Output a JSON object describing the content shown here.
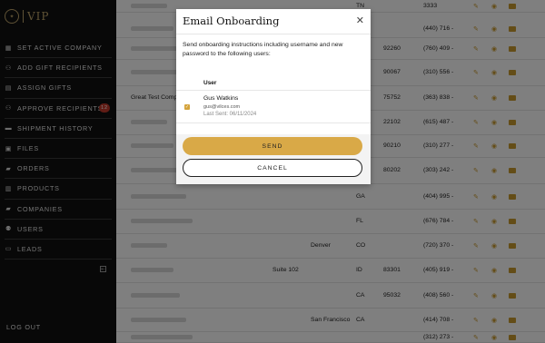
{
  "app": {
    "logo_text": "VIP"
  },
  "sidebar": {
    "items": [
      {
        "label": "SET ACTIVE COMPANY",
        "icon": "building-icon"
      },
      {
        "label": "ADD GIFT RECIPIENTS",
        "icon": "user-plus-icon"
      },
      {
        "label": "ASSIGN GIFTS",
        "icon": "gift-icon"
      },
      {
        "label": "APPROVE RECIPIENTS",
        "icon": "user-check-icon",
        "badge": "12"
      },
      {
        "label": "SHIPMENT HISTORY",
        "icon": "truck-icon"
      },
      {
        "label": "FILES",
        "icon": "image-icon"
      },
      {
        "label": "ORDERS",
        "icon": "folder-icon"
      },
      {
        "label": "PRODUCTS",
        "icon": "box-icon"
      },
      {
        "label": "COMPANIES",
        "icon": "folder-icon"
      },
      {
        "label": "USERS",
        "icon": "users-icon"
      },
      {
        "label": "LEADS",
        "icon": "inbox-icon"
      }
    ],
    "logout_label": "LOG OUT"
  },
  "table": {
    "rows": [
      {
        "company": "",
        "address2": "",
        "city": "",
        "state": "TN",
        "zip": "",
        "phone": "3333"
      },
      {
        "company": "",
        "address2": "",
        "city": "",
        "state": "",
        "zip": "",
        "phone": "(440) 716 -"
      },
      {
        "company": "",
        "address2": "",
        "city": "",
        "state": "",
        "zip": "92260",
        "phone": "(760) 409 -"
      },
      {
        "company": "",
        "address2": "",
        "city": "",
        "state": "",
        "zip": "90067",
        "phone": "(310) 556 -"
      },
      {
        "company": "Great Test Compa",
        "address2": "",
        "city": "",
        "state": "",
        "zip": "75752",
        "phone": "(363) 838 -"
      },
      {
        "company": "",
        "address2": "",
        "city": "",
        "state": "",
        "zip": "22102",
        "phone": "(615) 487 -"
      },
      {
        "company": "",
        "address2": "",
        "city": "",
        "state": "",
        "zip": "90210",
        "phone": "(310) 277 -"
      },
      {
        "company": "",
        "address2": "",
        "city": "",
        "state": "",
        "zip": "80202",
        "phone": "(303) 242 -"
      },
      {
        "company": "",
        "address2": "",
        "city": "",
        "state": "GA",
        "zip": "",
        "phone": "(404) 995 -"
      },
      {
        "company": "",
        "address2": "",
        "city": "",
        "state": "FL",
        "zip": "",
        "phone": "(676) 784 -"
      },
      {
        "company": "",
        "address2": "",
        "city": "Denver",
        "state": "CO",
        "zip": "",
        "phone": "(720) 370 -"
      },
      {
        "company": "",
        "address2": "Suite 102",
        "city": "",
        "state": "ID",
        "zip": "83301",
        "phone": "(405) 919 -"
      },
      {
        "company": "",
        "address2": "",
        "city": "",
        "state": "CA",
        "zip": "95032",
        "phone": "(408) 560 -"
      },
      {
        "company": "",
        "address2": "",
        "city": "San Francisco",
        "state": "CA",
        "zip": "",
        "phone": "(414) 708 -"
      },
      {
        "company": "",
        "address2": "",
        "city": "",
        "state": "",
        "zip": "",
        "phone": "(312) 273 -"
      }
    ]
  },
  "modal": {
    "title": "Email Onboarding",
    "description": "Send onboarding instructions including username and new password to the following users:",
    "column_user": "User",
    "user": {
      "name": "Gus Watkins",
      "email": "gus@vilces.com",
      "last_sent": "Last Sent: 06/11/2024",
      "checked": true
    },
    "send_label": "SEND",
    "cancel_label": "CANCEL"
  },
  "colors": {
    "accent": "#d9a947",
    "sidebar": "#111111",
    "badge": "#c0392b"
  }
}
